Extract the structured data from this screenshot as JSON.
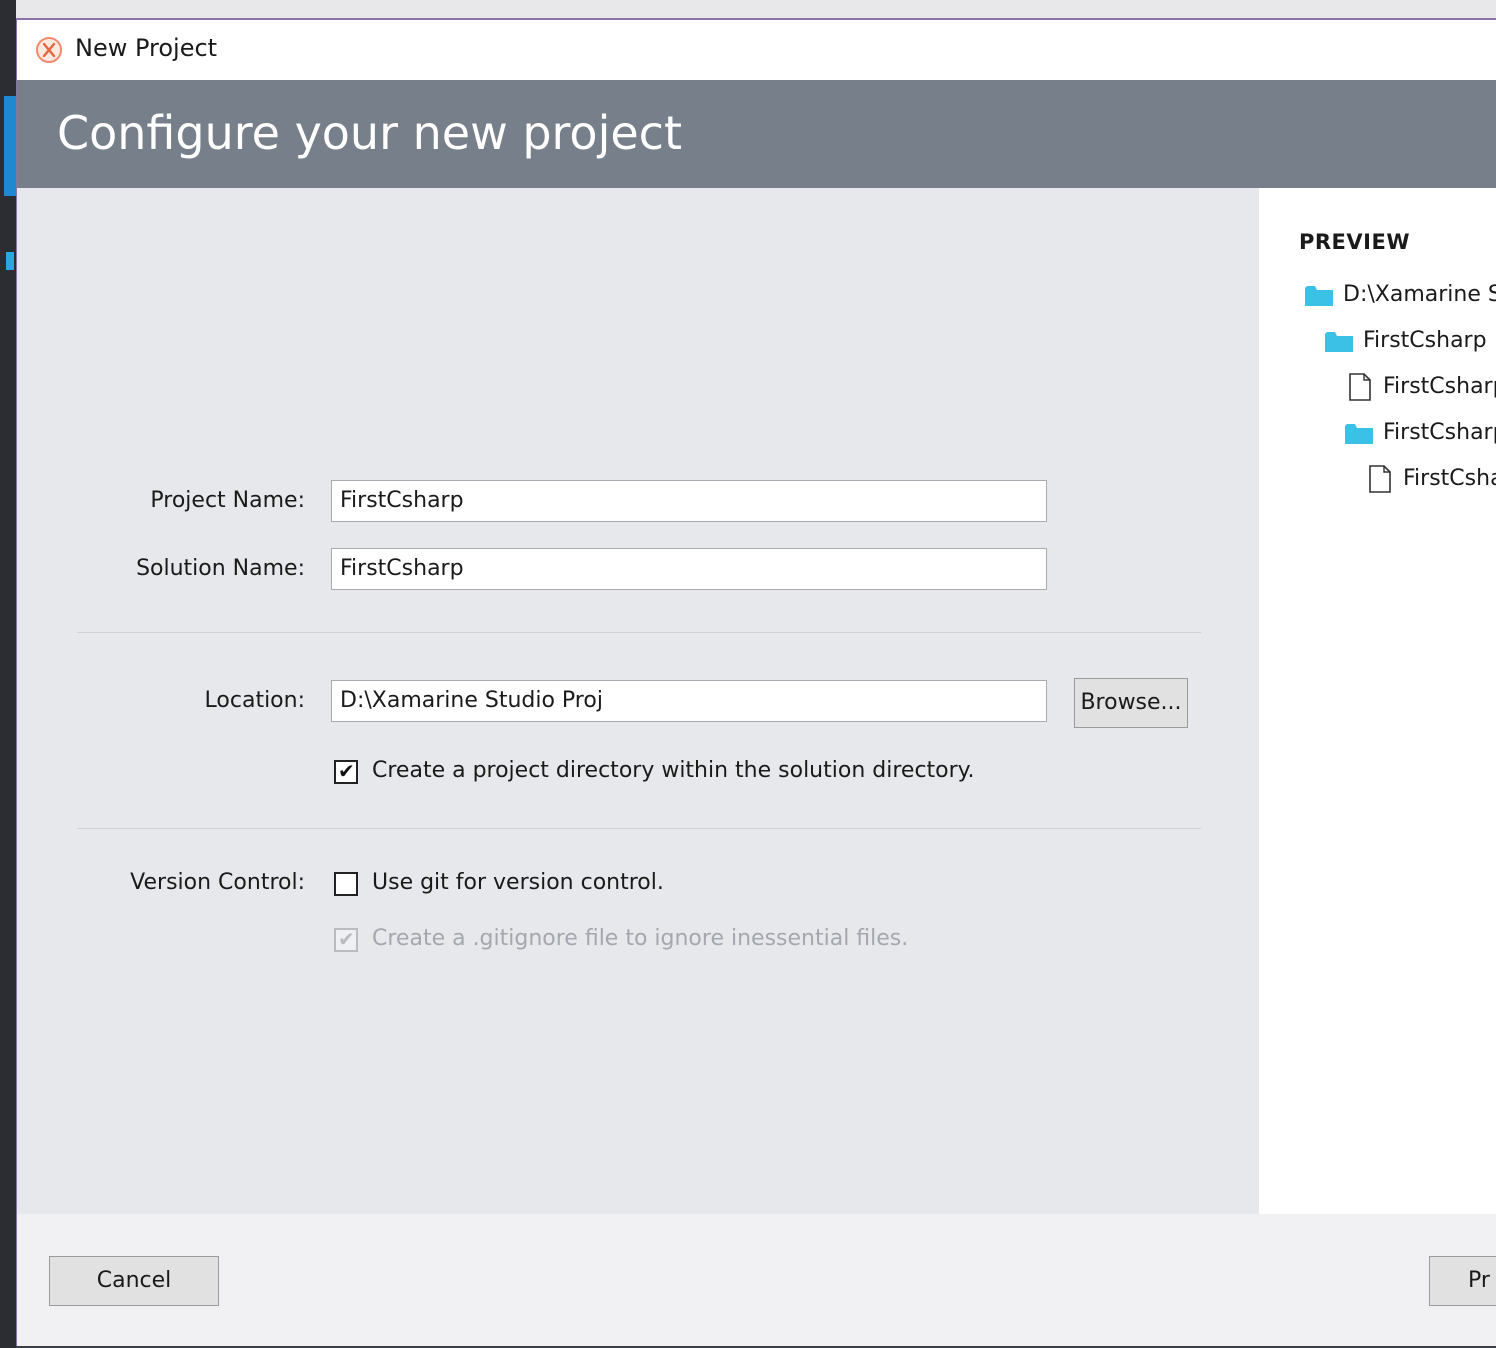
{
  "window": {
    "title": "New Project"
  },
  "header": {
    "title": "Configure your new project"
  },
  "form": {
    "project_name_label": "Project Name:",
    "project_name_value": "FirstCsharp",
    "solution_name_label": "Solution Name:",
    "solution_name_value": "FirstCsharp",
    "location_label": "Location:",
    "location_value": "D:\\Xamarine Studio Proj",
    "browse_label": "Browse...",
    "create_dir_checked": true,
    "create_dir_label": "Create a project directory within the solution directory.",
    "version_control_label": "Version Control:",
    "use_git_checked": false,
    "use_git_label": "Use git for version control.",
    "gitignore_checked": true,
    "gitignore_enabled": false,
    "gitignore_label": "Create a .gitignore file to ignore inessential files."
  },
  "preview": {
    "title": "PREVIEW",
    "items": [
      {
        "type": "folder",
        "label": "D:\\Xamarine St"
      },
      {
        "type": "folder",
        "label": "FirstCsharp"
      },
      {
        "type": "file",
        "label": "FirstCsharp"
      },
      {
        "type": "folder",
        "label": "FirstCsharp"
      },
      {
        "type": "file",
        "label": "FirstCsha"
      }
    ]
  },
  "footer": {
    "cancel_label": "Cancel",
    "next_label": "Pr"
  },
  "colors": {
    "header_band": "#77808a",
    "form_background": "#e6e8ec",
    "folder_icon": "#3bc1e6",
    "window_border": "#8a73a8"
  }
}
